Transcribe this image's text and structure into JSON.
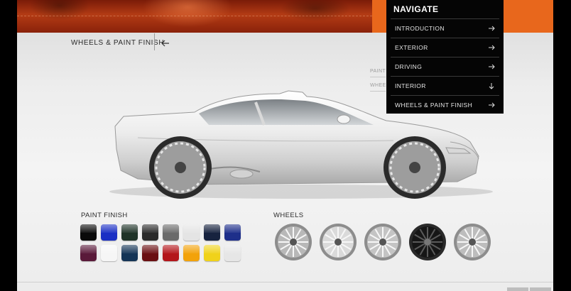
{
  "section": {
    "title": "WHEELS & PAINT FINISH"
  },
  "ghost_nav": {
    "items": [
      "PAINT",
      "WHEEL"
    ]
  },
  "nav": {
    "title": "NAVIGATE",
    "items": [
      {
        "label": "INTRODUCTION",
        "icon": "arrow-right-icon"
      },
      {
        "label": "EXTERIOR",
        "icon": "arrow-right-icon"
      },
      {
        "label": "DRIVING",
        "icon": "arrow-right-icon"
      },
      {
        "label": "INTERIOR",
        "icon": "arrow-down-icon"
      },
      {
        "label": "WHEELS & PAINT FINISH",
        "icon": "arrow-right-icon"
      }
    ]
  },
  "paint": {
    "label": "PAINT FINISH",
    "colors": [
      "#0a0a0a",
      "#1a2fc4",
      "#1f3328",
      "#2b2b2b",
      "#6a6a6a",
      "#e4e4e4",
      "#17233f",
      "#1e2f8a",
      "#5a1a3a",
      "#f6f6f6",
      "#143456",
      "#6a0f12",
      "#b3161b",
      "#f2a20a",
      "#f0d21a",
      "#e6e6e6"
    ]
  },
  "wheels": {
    "label": "WHEELS",
    "finishes": [
      "#b8b8b8",
      "#dadada",
      "#c4c4c4",
      "#161616",
      "#bdbdbd"
    ]
  }
}
